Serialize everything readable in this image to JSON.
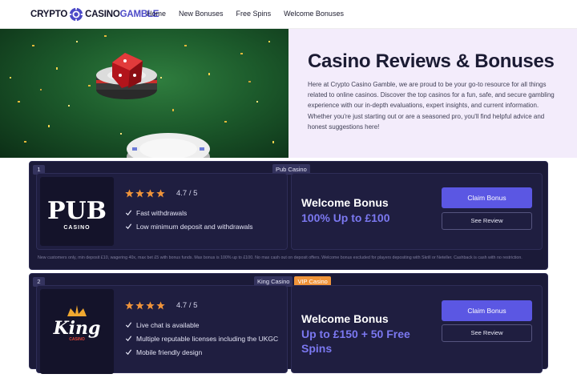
{
  "header": {
    "logo": {
      "part1": "CRYPTO",
      "part2": "CASINO",
      "part3": "GAMBLE"
    },
    "nav": [
      "Home",
      "New Bonuses",
      "Free Spins",
      "Welcome Bonuses"
    ]
  },
  "hero": {
    "title": "Casino Reviews & Bonuses",
    "text": "Here at Crypto Casino Gamble, we are proud to be your go-to resource for all things related to online casinos. Discover the top casinos for a fun, safe, and secure gambling experience with our in-depth evaluations, expert insights, and current information. Whether you're just starting out or are a seasoned pro, you'll find helpful advice and honest suggestions here!"
  },
  "casinos": [
    {
      "rank": "1",
      "tags": [
        "Pub Casino"
      ],
      "logo_text": "PUB",
      "logo_sub": "CASINO",
      "stars": 4,
      "rating": "4.7 / 5",
      "features": [
        "Fast withdrawals",
        "Low minimum deposit and withdrawals"
      ],
      "bonus_title": "Welcome Bonus",
      "bonus_value": "100% Up to £100",
      "claim_label": "Claim Bonus",
      "review_label": "See Review",
      "terms": "New customers only, min deposit £10, wagering 40x, max bet £5 with bonus funds. Max bonus is 100% up to £100. No max cash out on deposit offers. Welcome bonus excluded for players depositing with Skrill or Neteller. Cashback is cash with no restriction."
    },
    {
      "rank": "2",
      "tags": [
        "King Casino",
        "VIP Casino"
      ],
      "logo_text": "King",
      "logo_sub": "CASINO",
      "stars": 4,
      "rating": "4.7 / 5",
      "features": [
        "Live chat is available",
        "Multiple reputable licenses including the UKGC",
        "Mobile friendly design"
      ],
      "bonus_title": "Welcome Bonus",
      "bonus_value": "Up to £150 + 50 Free Spins",
      "claim_label": "Claim Bonus",
      "review_label": "See Review"
    }
  ],
  "colors": {
    "accent": "#5b57e3",
    "card_bg": "#1b1a38",
    "star": "#f0943a",
    "vip": "#f0943a",
    "hero_bg": "#f3ecfb"
  }
}
